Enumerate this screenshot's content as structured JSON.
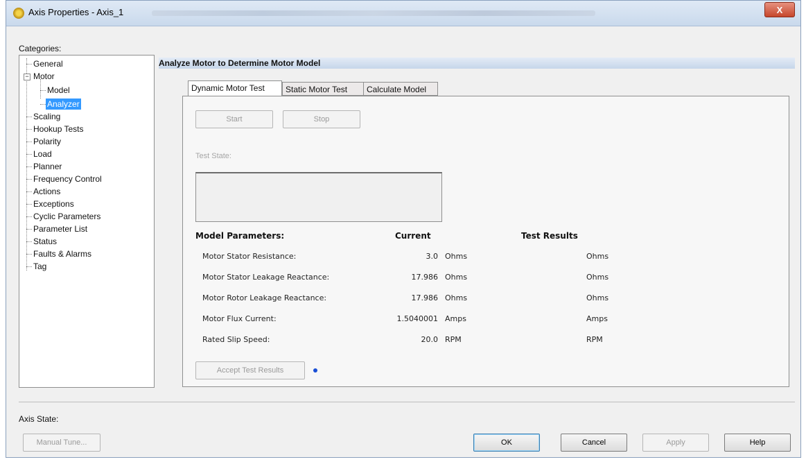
{
  "window": {
    "title": "Axis Properties - Axis_1",
    "close_label": "X"
  },
  "categories_label": "Categories:",
  "tree": {
    "items": [
      {
        "label": "General"
      },
      {
        "label": "Motor"
      },
      {
        "label": "Model"
      },
      {
        "label": "Analyzer",
        "selected": true
      },
      {
        "label": "Scaling"
      },
      {
        "label": "Hookup Tests"
      },
      {
        "label": "Polarity"
      },
      {
        "label": "Load"
      },
      {
        "label": "Planner"
      },
      {
        "label": "Frequency Control"
      },
      {
        "label": "Actions"
      },
      {
        "label": "Exceptions"
      },
      {
        "label": "Cyclic Parameters"
      },
      {
        "label": "Parameter List"
      },
      {
        "label": "Status"
      },
      {
        "label": "Faults & Alarms"
      },
      {
        "label": "Tag"
      }
    ]
  },
  "section_title": "Analyze Motor to Determine Motor Model",
  "tabs": [
    {
      "label": "Dynamic Motor Test",
      "active": true
    },
    {
      "label": "Static Motor Test"
    },
    {
      "label": "Calculate Model"
    }
  ],
  "panel": {
    "start_label": "Start",
    "stop_label": "Stop",
    "test_state_label": "Test State:",
    "headers": {
      "params": "Model Parameters:",
      "current": "Current",
      "results": "Test Results"
    },
    "rows": [
      {
        "name": "Motor Stator Resistance:",
        "value": "3.0",
        "unit": "Ohms",
        "result_unit": "Ohms"
      },
      {
        "name": "Motor Stator Leakage Reactance:",
        "value": "17.986",
        "unit": "Ohms",
        "result_unit": "Ohms"
      },
      {
        "name": "Motor Rotor Leakage Reactance:",
        "value": "17.986",
        "unit": "Ohms",
        "result_unit": "Ohms"
      },
      {
        "name": "Motor Flux Current:",
        "value": "1.5040001",
        "unit": "Amps",
        "result_unit": "Amps"
      },
      {
        "name": "Rated Slip Speed:",
        "value": "20.0",
        "unit": "RPM",
        "result_unit": "RPM"
      }
    ],
    "accept_label": "Accept Test Results"
  },
  "footer": {
    "axis_state_label": "Axis State:",
    "manual_tune_label": "Manual Tune...",
    "ok_label": "OK",
    "cancel_label": "Cancel",
    "apply_label": "Apply",
    "help_label": "Help"
  }
}
